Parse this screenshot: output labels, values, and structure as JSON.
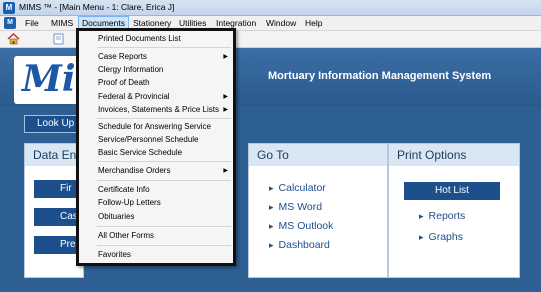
{
  "window": {
    "title": "MIMS ™ - [Main Menu - 1: Clare, Erica J]",
    "app_icon": "M"
  },
  "menubar": {
    "items": [
      "File",
      "MIMS",
      "Documents",
      "Stationery",
      "Utilities",
      "Integration",
      "Window",
      "Help"
    ],
    "active": "Documents"
  },
  "header": {
    "logo": "Mi",
    "system_title": "Mortuary Information Management System"
  },
  "lookup": {
    "label": "Look Up"
  },
  "data_entry": {
    "title": "Data En",
    "buttons": [
      "Fir",
      "Cas",
      "Pre"
    ]
  },
  "goto": {
    "title": "Go To",
    "links": [
      "Calculator",
      "MS Word",
      "MS Outlook",
      "Dashboard"
    ]
  },
  "print_options": {
    "title": "Print Options",
    "hot_list": "Hot List",
    "links": [
      "Reports",
      "Graphs"
    ]
  },
  "documents_menu": {
    "items": [
      {
        "label": "Printed Documents List",
        "submenu": false
      },
      {
        "label": "Case Reports",
        "submenu": true
      },
      {
        "label": "Clergy Information",
        "submenu": false
      },
      {
        "label": "Proof of Death",
        "submenu": false
      },
      {
        "label": "Federal & Provincial",
        "submenu": true
      },
      {
        "label": "Invoices, Statements & Price Lists",
        "submenu": true
      },
      {
        "label": "Schedule for Answering Service",
        "submenu": false
      },
      {
        "label": "Service/Personnel Schedule",
        "submenu": false
      },
      {
        "label": "Basic Service Schedule",
        "submenu": false
      },
      {
        "label": "Merchandise Orders",
        "submenu": true
      },
      {
        "label": "Certificate Info",
        "submenu": false
      },
      {
        "label": "Follow-Up Letters",
        "submenu": false
      },
      {
        "label": "Obituaries",
        "submenu": false
      },
      {
        "label": "All Other Forms",
        "submenu": false
      },
      {
        "label": "Favorites",
        "submenu": false
      }
    ],
    "submenu_arrow": "▶"
  },
  "colors": {
    "brand_blue": "#1c4f8c",
    "header_blue": "#2d5f93",
    "menu_highlight": "#cce4f7"
  }
}
